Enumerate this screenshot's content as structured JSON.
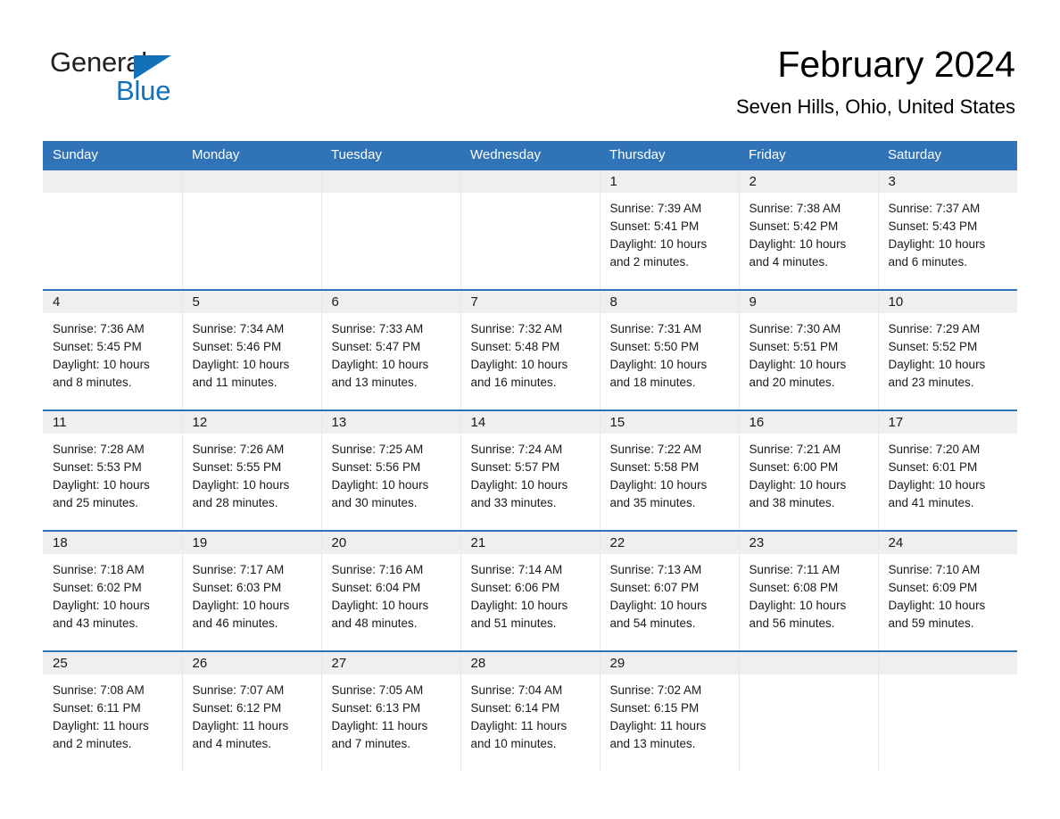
{
  "brand": {
    "name_part1": "General",
    "name_part2": "Blue",
    "accent_color": "#1371b8"
  },
  "header": {
    "title": "February 2024",
    "location": "Seven Hills, Ohio, United States",
    "header_bg_color": "#3073b7",
    "daynum_band_color": "#efefef"
  },
  "weekday_headers": [
    "Sunday",
    "Monday",
    "Tuesday",
    "Wednesday",
    "Thursday",
    "Friday",
    "Saturday"
  ],
  "weeks": [
    [
      {
        "day": "",
        "lines": []
      },
      {
        "day": "",
        "lines": []
      },
      {
        "day": "",
        "lines": []
      },
      {
        "day": "",
        "lines": []
      },
      {
        "day": "1",
        "lines": [
          "Sunrise: 7:39 AM",
          "Sunset: 5:41 PM",
          "Daylight: 10 hours",
          "and 2 minutes."
        ]
      },
      {
        "day": "2",
        "lines": [
          "Sunrise: 7:38 AM",
          "Sunset: 5:42 PM",
          "Daylight: 10 hours",
          "and 4 minutes."
        ]
      },
      {
        "day": "3",
        "lines": [
          "Sunrise: 7:37 AM",
          "Sunset: 5:43 PM",
          "Daylight: 10 hours",
          "and 6 minutes."
        ]
      }
    ],
    [
      {
        "day": "4",
        "lines": [
          "Sunrise: 7:36 AM",
          "Sunset: 5:45 PM",
          "Daylight: 10 hours",
          "and 8 minutes."
        ]
      },
      {
        "day": "5",
        "lines": [
          "Sunrise: 7:34 AM",
          "Sunset: 5:46 PM",
          "Daylight: 10 hours",
          "and 11 minutes."
        ]
      },
      {
        "day": "6",
        "lines": [
          "Sunrise: 7:33 AM",
          "Sunset: 5:47 PM",
          "Daylight: 10 hours",
          "and 13 minutes."
        ]
      },
      {
        "day": "7",
        "lines": [
          "Sunrise: 7:32 AM",
          "Sunset: 5:48 PM",
          "Daylight: 10 hours",
          "and 16 minutes."
        ]
      },
      {
        "day": "8",
        "lines": [
          "Sunrise: 7:31 AM",
          "Sunset: 5:50 PM",
          "Daylight: 10 hours",
          "and 18 minutes."
        ]
      },
      {
        "day": "9",
        "lines": [
          "Sunrise: 7:30 AM",
          "Sunset: 5:51 PM",
          "Daylight: 10 hours",
          "and 20 minutes."
        ]
      },
      {
        "day": "10",
        "lines": [
          "Sunrise: 7:29 AM",
          "Sunset: 5:52 PM",
          "Daylight: 10 hours",
          "and 23 minutes."
        ]
      }
    ],
    [
      {
        "day": "11",
        "lines": [
          "Sunrise: 7:28 AM",
          "Sunset: 5:53 PM",
          "Daylight: 10 hours",
          "and 25 minutes."
        ]
      },
      {
        "day": "12",
        "lines": [
          "Sunrise: 7:26 AM",
          "Sunset: 5:55 PM",
          "Daylight: 10 hours",
          "and 28 minutes."
        ]
      },
      {
        "day": "13",
        "lines": [
          "Sunrise: 7:25 AM",
          "Sunset: 5:56 PM",
          "Daylight: 10 hours",
          "and 30 minutes."
        ]
      },
      {
        "day": "14",
        "lines": [
          "Sunrise: 7:24 AM",
          "Sunset: 5:57 PM",
          "Daylight: 10 hours",
          "and 33 minutes."
        ]
      },
      {
        "day": "15",
        "lines": [
          "Sunrise: 7:22 AM",
          "Sunset: 5:58 PM",
          "Daylight: 10 hours",
          "and 35 minutes."
        ]
      },
      {
        "day": "16",
        "lines": [
          "Sunrise: 7:21 AM",
          "Sunset: 6:00 PM",
          "Daylight: 10 hours",
          "and 38 minutes."
        ]
      },
      {
        "day": "17",
        "lines": [
          "Sunrise: 7:20 AM",
          "Sunset: 6:01 PM",
          "Daylight: 10 hours",
          "and 41 minutes."
        ]
      }
    ],
    [
      {
        "day": "18",
        "lines": [
          "Sunrise: 7:18 AM",
          "Sunset: 6:02 PM",
          "Daylight: 10 hours",
          "and 43 minutes."
        ]
      },
      {
        "day": "19",
        "lines": [
          "Sunrise: 7:17 AM",
          "Sunset: 6:03 PM",
          "Daylight: 10 hours",
          "and 46 minutes."
        ]
      },
      {
        "day": "20",
        "lines": [
          "Sunrise: 7:16 AM",
          "Sunset: 6:04 PM",
          "Daylight: 10 hours",
          "and 48 minutes."
        ]
      },
      {
        "day": "21",
        "lines": [
          "Sunrise: 7:14 AM",
          "Sunset: 6:06 PM",
          "Daylight: 10 hours",
          "and 51 minutes."
        ]
      },
      {
        "day": "22",
        "lines": [
          "Sunrise: 7:13 AM",
          "Sunset: 6:07 PM",
          "Daylight: 10 hours",
          "and 54 minutes."
        ]
      },
      {
        "day": "23",
        "lines": [
          "Sunrise: 7:11 AM",
          "Sunset: 6:08 PM",
          "Daylight: 10 hours",
          "and 56 minutes."
        ]
      },
      {
        "day": "24",
        "lines": [
          "Sunrise: 7:10 AM",
          "Sunset: 6:09 PM",
          "Daylight: 10 hours",
          "and 59 minutes."
        ]
      }
    ],
    [
      {
        "day": "25",
        "lines": [
          "Sunrise: 7:08 AM",
          "Sunset: 6:11 PM",
          "Daylight: 11 hours",
          "and 2 minutes."
        ]
      },
      {
        "day": "26",
        "lines": [
          "Sunrise: 7:07 AM",
          "Sunset: 6:12 PM",
          "Daylight: 11 hours",
          "and 4 minutes."
        ]
      },
      {
        "day": "27",
        "lines": [
          "Sunrise: 7:05 AM",
          "Sunset: 6:13 PM",
          "Daylight: 11 hours",
          "and 7 minutes."
        ]
      },
      {
        "day": "28",
        "lines": [
          "Sunrise: 7:04 AM",
          "Sunset: 6:14 PM",
          "Daylight: 11 hours",
          "and 10 minutes."
        ]
      },
      {
        "day": "29",
        "lines": [
          "Sunrise: 7:02 AM",
          "Sunset: 6:15 PM",
          "Daylight: 11 hours",
          "and 13 minutes."
        ]
      },
      {
        "day": "",
        "lines": []
      },
      {
        "day": "",
        "lines": []
      }
    ]
  ]
}
